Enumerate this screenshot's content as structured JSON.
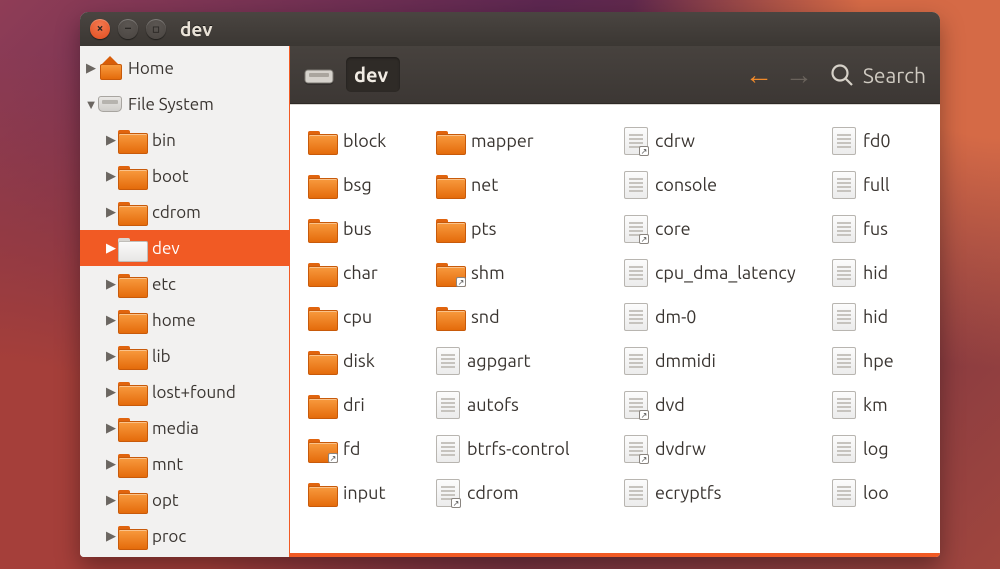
{
  "window": {
    "title": "dev"
  },
  "toolbar": {
    "path_label": "dev",
    "search_label": "Search"
  },
  "sidebar": {
    "items": [
      {
        "label": "Home",
        "depth": 0,
        "icon": "home",
        "exp": "right",
        "selected": false
      },
      {
        "label": "File System",
        "depth": 0,
        "icon": "drive",
        "exp": "down",
        "selected": false
      },
      {
        "label": "bin",
        "depth": 1,
        "icon": "folder",
        "exp": "right",
        "selected": false
      },
      {
        "label": "boot",
        "depth": 1,
        "icon": "folder",
        "exp": "right",
        "selected": false
      },
      {
        "label": "cdrom",
        "depth": 1,
        "icon": "folder",
        "exp": "right",
        "selected": false
      },
      {
        "label": "dev",
        "depth": 1,
        "icon": "folder-white",
        "exp": "right",
        "selected": true
      },
      {
        "label": "etc",
        "depth": 1,
        "icon": "folder",
        "exp": "right",
        "selected": false
      },
      {
        "label": "home",
        "depth": 1,
        "icon": "folder",
        "exp": "right",
        "selected": false
      },
      {
        "label": "lib",
        "depth": 1,
        "icon": "folder",
        "exp": "right",
        "selected": false
      },
      {
        "label": "lost+found",
        "depth": 1,
        "icon": "folder",
        "exp": "right",
        "selected": false
      },
      {
        "label": "media",
        "depth": 1,
        "icon": "folder",
        "exp": "right",
        "selected": false
      },
      {
        "label": "mnt",
        "depth": 1,
        "icon": "folder",
        "exp": "right",
        "selected": false
      },
      {
        "label": "opt",
        "depth": 1,
        "icon": "folder",
        "exp": "right",
        "selected": false
      },
      {
        "label": "proc",
        "depth": 1,
        "icon": "folder",
        "exp": "right",
        "selected": false
      }
    ]
  },
  "content": {
    "columns": [
      [
        {
          "label": "block",
          "kind": "folder"
        },
        {
          "label": "bsg",
          "kind": "folder"
        },
        {
          "label": "bus",
          "kind": "folder"
        },
        {
          "label": "char",
          "kind": "folder"
        },
        {
          "label": "cpu",
          "kind": "folder"
        },
        {
          "label": "disk",
          "kind": "folder"
        },
        {
          "label": "dri",
          "kind": "folder"
        },
        {
          "label": "fd",
          "kind": "folder-link"
        },
        {
          "label": "input",
          "kind": "folder"
        }
      ],
      [
        {
          "label": "mapper",
          "kind": "folder"
        },
        {
          "label": "net",
          "kind": "folder"
        },
        {
          "label": "pts",
          "kind": "folder"
        },
        {
          "label": "shm",
          "kind": "folder-link"
        },
        {
          "label": "snd",
          "kind": "folder"
        },
        {
          "label": "agpgart",
          "kind": "file"
        },
        {
          "label": "autofs",
          "kind": "file"
        },
        {
          "label": "btrfs-control",
          "kind": "file"
        },
        {
          "label": "cdrom",
          "kind": "file-link"
        }
      ],
      [
        {
          "label": "cdrw",
          "kind": "file-link"
        },
        {
          "label": "console",
          "kind": "file"
        },
        {
          "label": "core",
          "kind": "file-link"
        },
        {
          "label": "cpu_dma_latency",
          "kind": "file"
        },
        {
          "label": "dm-0",
          "kind": "file"
        },
        {
          "label": "dmmidi",
          "kind": "file"
        },
        {
          "label": "dvd",
          "kind": "file-link"
        },
        {
          "label": "dvdrw",
          "kind": "file-link"
        },
        {
          "label": "ecryptfs",
          "kind": "file"
        }
      ],
      [
        {
          "label": "fd0",
          "kind": "file"
        },
        {
          "label": "full",
          "kind": "file"
        },
        {
          "label": "fus",
          "kind": "file"
        },
        {
          "label": "hid",
          "kind": "file"
        },
        {
          "label": "hid",
          "kind": "file"
        },
        {
          "label": "hpe",
          "kind": "file"
        },
        {
          "label": "km",
          "kind": "file"
        },
        {
          "label": "log",
          "kind": "file"
        },
        {
          "label": "loo",
          "kind": "file"
        }
      ]
    ]
  }
}
